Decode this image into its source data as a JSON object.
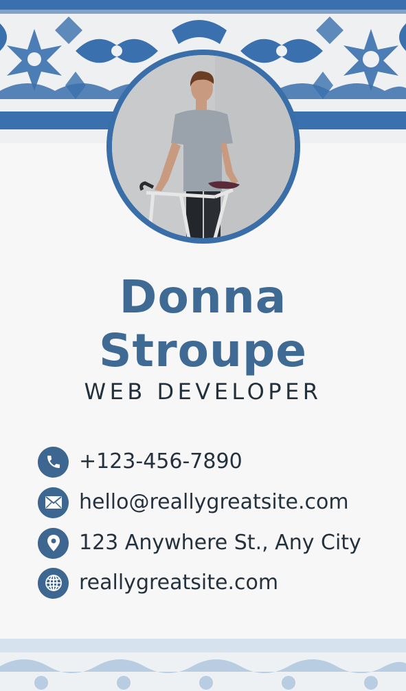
{
  "person": {
    "first_name": "Donna",
    "last_name": "Stroupe",
    "job_title": "WEB DEVELOPER"
  },
  "contacts": [
    {
      "icon": "phone-icon",
      "text": "+123-456-7890"
    },
    {
      "icon": "email-icon",
      "text": "hello@reallygreatsite.com"
    },
    {
      "icon": "location-pin-icon",
      "text": "123 Anywhere St., Any City"
    },
    {
      "icon": "globe-icon",
      "text": "reallygreatsite.com"
    }
  ],
  "colors": {
    "accent_blue": "#3a70ad",
    "name_blue": "#3f6a93",
    "icon_circle": "#3d6690",
    "text_dark": "#25323e",
    "background": "#f7f7f7"
  }
}
